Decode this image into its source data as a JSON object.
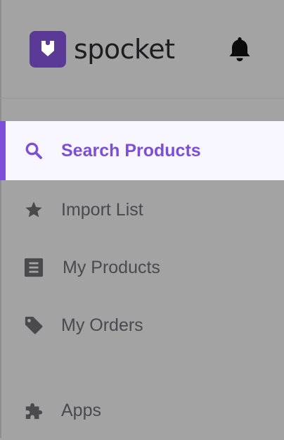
{
  "brand": {
    "name": "spocket",
    "accent_color": "#7d4fd6",
    "logo_color": "#5a3a96"
  },
  "header": {
    "notification_icon": "bell-icon"
  },
  "nav": {
    "items": [
      {
        "label": "Search Products",
        "icon": "search-icon",
        "active": true
      },
      {
        "label": "Import List",
        "icon": "star-icon",
        "active": false
      },
      {
        "label": "My Products",
        "icon": "list-icon",
        "active": false
      },
      {
        "label": "My Orders",
        "icon": "tag-icon",
        "active": false
      },
      {
        "label": "Apps",
        "icon": "puzzle-icon",
        "active": false
      }
    ]
  }
}
